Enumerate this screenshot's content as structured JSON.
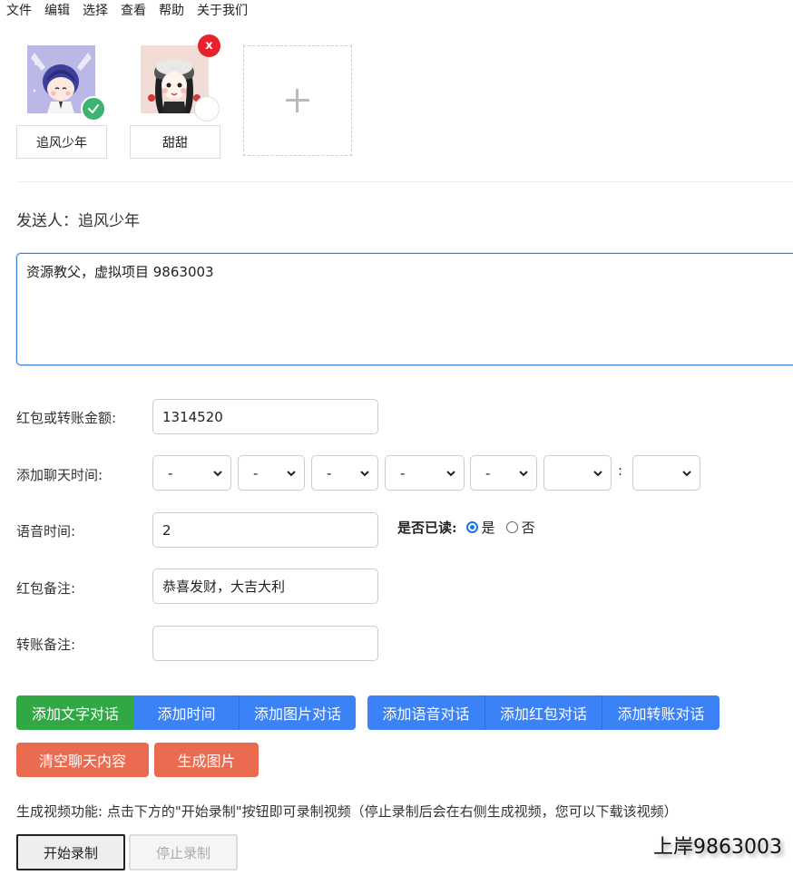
{
  "menu": [
    "文件",
    "编辑",
    "选择",
    "查看",
    "帮助",
    "关于我们"
  ],
  "contacts": [
    {
      "name": "追风少年",
      "selected": true
    },
    {
      "name": "甜甜",
      "selected": false,
      "remove_label": "x"
    }
  ],
  "add_contact_symbol": "+",
  "sender": {
    "label": "发送人：",
    "name": "追风少年"
  },
  "message": {
    "value": "资源教父，虚拟项目 9863003"
  },
  "form": {
    "amount_label": "红包或转账金额:",
    "amount_value": "1314520",
    "time_label": "添加聊天时间:",
    "time_selects": [
      "-",
      "-",
      "-",
      "-",
      "-",
      "",
      ""
    ],
    "time_colon": ":",
    "voice_label": "语音时间:",
    "voice_value": "2",
    "read_label": "是否已读:",
    "read_options": [
      "是",
      "否"
    ],
    "read_selected": "是",
    "redpacket_note_label": "红包备注:",
    "redpacket_note_value": "恭喜发财，大吉大利",
    "transfer_note_label": "转账备注:",
    "transfer_note_value": ""
  },
  "buttons": {
    "add_text": "添加文字对话",
    "add_time": "添加时间",
    "add_image": "添加图片对话",
    "add_voice": "添加语音对话",
    "add_redpacket": "添加红包对话",
    "add_transfer": "添加转账对话",
    "clear": "清空聊天内容",
    "generate_image": "生成图片"
  },
  "video": {
    "description": "生成视频功能: 点击下方的\"开始录制\"按钮即可录制视频（停止录制后会在右侧生成视频，您可以下载该视频）",
    "start": "开始录制",
    "stop": "停止录制"
  },
  "watermark": "上岸9863003",
  "colors": {
    "green": "#32a845",
    "blue": "#3b82f6",
    "red": "#ea6b4f",
    "focus": "#3b7ddd",
    "badge_check": "#3cb371",
    "badge_close": "#e8222a"
  }
}
